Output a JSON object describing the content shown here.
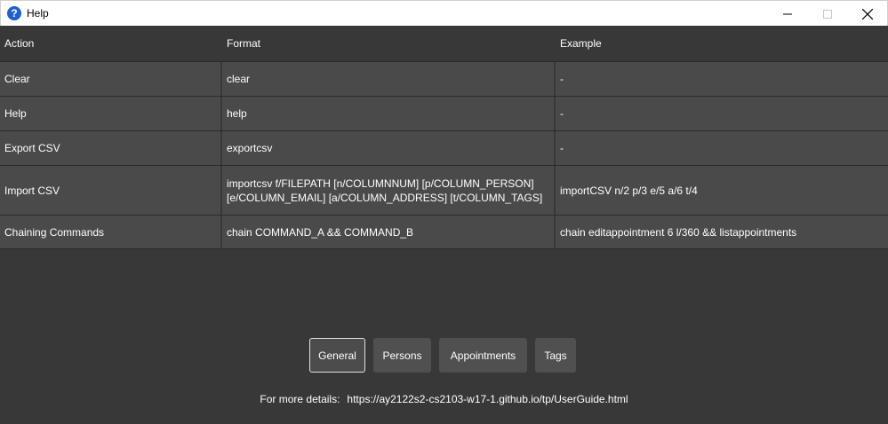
{
  "window": {
    "icon": "question-icon",
    "icon_glyph": "?",
    "title": "Help",
    "controls": [
      "minimize-icon",
      "maximize-icon",
      "close-icon"
    ]
  },
  "table": {
    "headers": [
      "Action",
      "Format",
      "Example"
    ],
    "rows": [
      {
        "action": "Clear",
        "format": "clear",
        "example": "-"
      },
      {
        "action": "Help",
        "format": "help",
        "example": "-"
      },
      {
        "action": "Export CSV",
        "format": "exportcsv",
        "example": "-"
      },
      {
        "action": "Import CSV",
        "format_line1": "importcsv f/FILEPATH [n/COLUMNNUM] [p/COLUMN_PERSON]",
        "format_line2": "[e/COLUMN_EMAIL] [a/COLUMN_ADDRESS] [t/COLUMN_TAGS]",
        "example": "importCSV n/2 p/3 e/5 a/6 t/4"
      },
      {
        "action": "Chaining Commands",
        "format": "chain COMMAND_A && COMMAND_B",
        "example": "chain editappointment 6 l/360 && listappointments"
      }
    ]
  },
  "tabs": [
    {
      "label": "General",
      "active": true
    },
    {
      "label": "Persons",
      "active": false
    },
    {
      "label": "Appointments",
      "active": false
    },
    {
      "label": "Tags",
      "active": false
    }
  ],
  "footer": {
    "label": "For more details:",
    "url": "https://ay2122s2-cs2103-w17-1.github.io/tp/UserGuide.html"
  },
  "colors": {
    "background": "#383838",
    "row": "#4a4a4a",
    "button": "#505050",
    "active_border": "#e0e0e0",
    "text": "#ffffff",
    "icon_blue": "#1e5fd0"
  }
}
